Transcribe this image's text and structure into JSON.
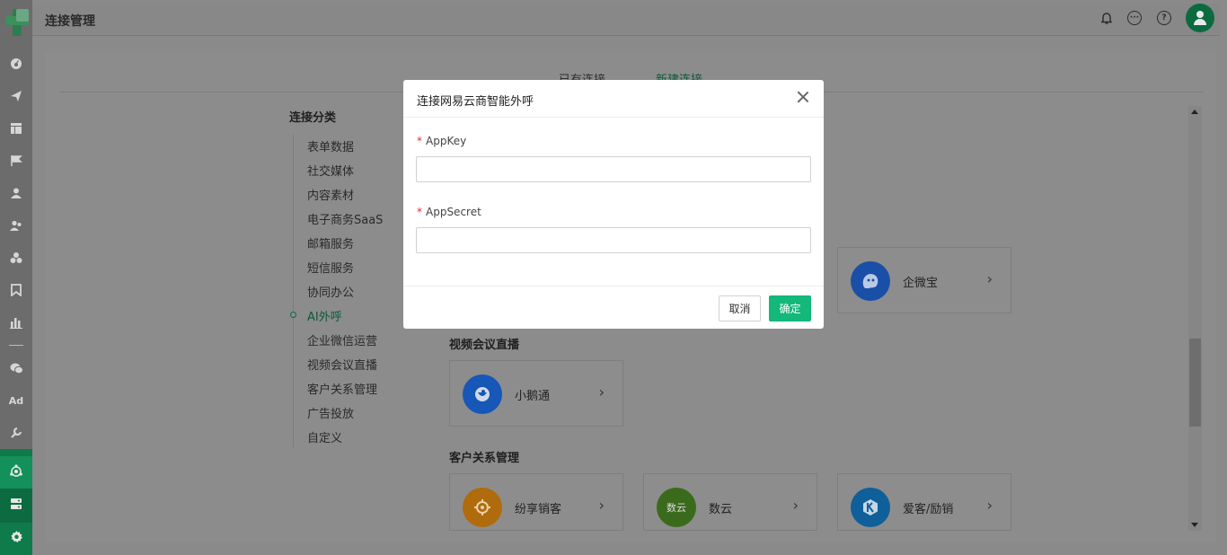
{
  "header": {
    "title": "连接管理"
  },
  "tabs": [
    {
      "label": "已有连接"
    },
    {
      "label": "新建连接"
    }
  ],
  "categories": {
    "title": "连接分类",
    "items": [
      {
        "label": "表单数据"
      },
      {
        "label": "社交媒体"
      },
      {
        "label": "内容素材"
      },
      {
        "label": "电子商务SaaS"
      },
      {
        "label": "邮箱服务"
      },
      {
        "label": "短信服务"
      },
      {
        "label": "协同办公"
      },
      {
        "label": "AI外呼"
      },
      {
        "label": "企业微信运营"
      },
      {
        "label": "视频会议直播"
      },
      {
        "label": "客户关系管理"
      },
      {
        "label": "广告投放"
      },
      {
        "label": "自定义"
      }
    ],
    "active": "AI外呼"
  },
  "sections": [
    {
      "title": "",
      "cards": [
        {
          "name": "企微宝",
          "icon": "qiweibao-logo-icon",
          "color": "#1a4fa8"
        }
      ]
    },
    {
      "title": "视频会议直播",
      "cards": [
        {
          "name": "小鹅通",
          "icon": "xiaoetong-logo-icon",
          "color": "#1657b8"
        }
      ]
    },
    {
      "title": "客户关系管理",
      "cards": [
        {
          "name": "纷享销客",
          "icon": "fenxiang-logo-icon",
          "color": "#b06b0c"
        },
        {
          "name": "数云",
          "icon": "shuyun-logo-icon",
          "color": "#3a6b1c",
          "icon_text": "数云"
        },
        {
          "name": "爱客/励销",
          "icon": "aike-logo-icon",
          "color": "#0f5f9a"
        }
      ]
    }
  ],
  "modal": {
    "title": "连接网易云商智能外呼",
    "fields": [
      {
        "label": "AppKey",
        "required": true,
        "value": "",
        "placeholder": ""
      },
      {
        "label": "AppSecret",
        "required": true,
        "value": "",
        "placeholder": ""
      }
    ],
    "cancel_label": "取消",
    "ok_label": "确定"
  },
  "nav_ad_label": "Ad",
  "colors": {
    "accent": "#13b87a",
    "required": "#f5222d",
    "nav_active": "#0f7a4a"
  }
}
